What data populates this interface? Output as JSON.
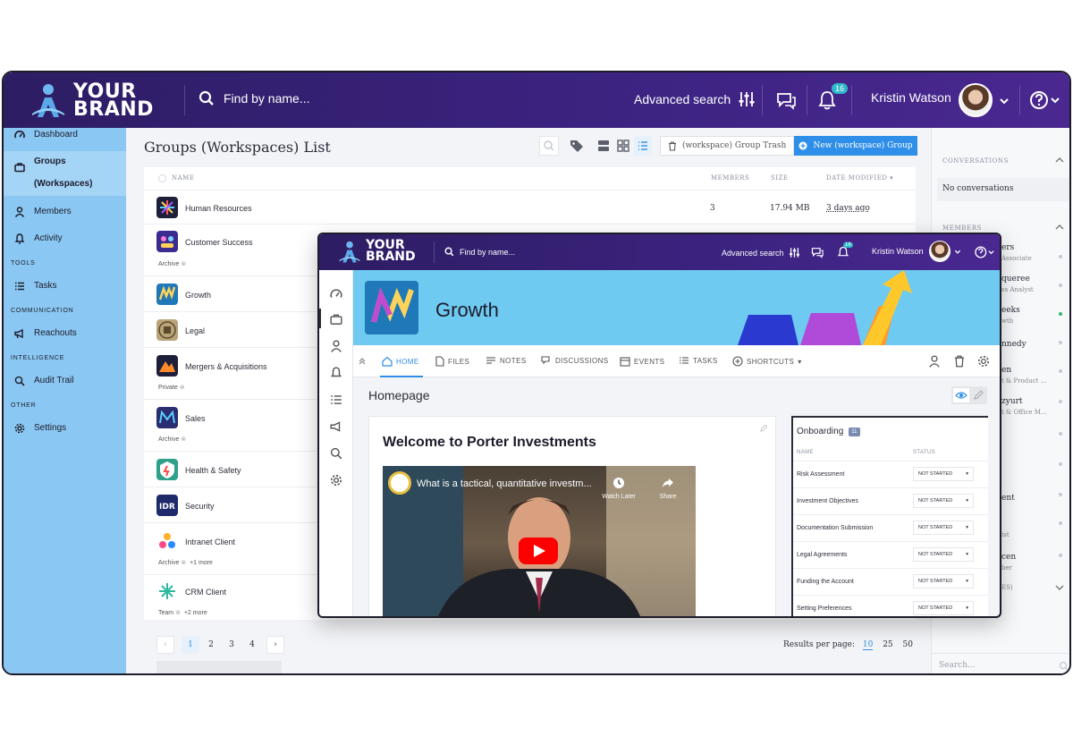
{
  "brand": {
    "line1": "YOUR",
    "line2": "BRAND"
  },
  "header": {
    "search_placeholder": "Find by name...",
    "advanced_search": "Advanced search",
    "notifications_count": "16",
    "user_name": "Kristin Watson"
  },
  "sidebar": {
    "items": [
      {
        "label": "Dashboard",
        "icon": "dashboard-icon"
      },
      {
        "label": "Groups (Workspaces)",
        "icon": "briefcase-icon",
        "active": true
      },
      {
        "label": "Members",
        "icon": "person-icon"
      },
      {
        "label": "Activity",
        "icon": "bell-icon"
      }
    ],
    "sections": {
      "tools": "TOOLS",
      "communication": "COMMUNICATION",
      "intelligence": "INTELLIGENCE",
      "other": "OTHER"
    },
    "tasks": "Tasks",
    "reachouts": "Reachouts",
    "audit_trail": "Audit Trail",
    "settings": "Settings"
  },
  "main": {
    "title": "Groups (Workspaces) List",
    "trash_label": "(workspace) Group Trash",
    "new_label": "New (workspace) Group",
    "columns": {
      "name": "NAME",
      "members": "MEMBERS",
      "size": "SIZE",
      "date_modified": "DATE MODIFIED"
    },
    "rows": [
      {
        "name": "Human Resources",
        "members": "3",
        "size": "17.94 MB",
        "modified": "3 days ago",
        "tag": "",
        "extra": ""
      },
      {
        "name": "Customer Success",
        "tag": "Archive",
        "extra": ""
      },
      {
        "name": "Growth",
        "tag": "",
        "extra": ""
      },
      {
        "name": "Legal",
        "tag": "",
        "extra": ""
      },
      {
        "name": "Mergers & Acquisitions",
        "tag": "Private",
        "extra": ""
      },
      {
        "name": "Sales",
        "tag": "Archive",
        "extra": ""
      },
      {
        "name": "Health & Safety",
        "tag": "",
        "extra": ""
      },
      {
        "name": "Security",
        "tag": "",
        "extra": ""
      },
      {
        "name": "Intranet Client",
        "tag": "Archive",
        "extra": "+1 more"
      },
      {
        "name": "CRM Client",
        "tag": "Team",
        "extra": "+2 more"
      }
    ],
    "pages": [
      "1",
      "2",
      "3",
      "4"
    ],
    "results_label": "Results per page:",
    "per_page": [
      "10",
      "25",
      "50"
    ]
  },
  "right_panel": {
    "conversations": "CONVERSATIONS",
    "no_conversations": "No conversations",
    "members": "MEMBERS",
    "partial": [
      {
        "name": "ers",
        "sub": "Associate"
      },
      {
        "name": "queree",
        "sub": "ss Analyst"
      },
      {
        "name": "eeks",
        "sub": "wth"
      },
      {
        "name": "nnedy",
        "sub": ""
      },
      {
        "name": "en",
        "sub": "t & Product ..."
      },
      {
        "name": "zyurt",
        "sub": "t & Office M..."
      },
      {
        "name": "ent",
        "sub": ""
      },
      {
        "name": "",
        "sub": "ist"
      },
      {
        "name": "cen",
        "sub": "ber"
      },
      {
        "name": "ES)",
        "sub": ""
      }
    ],
    "search_placeholder": "Search..."
  },
  "overlay": {
    "search_placeholder": "Find by name...",
    "advanced_search": "Advanced search",
    "notifications_count": "16",
    "user_name": "Kristin Watson",
    "group_title": "Growth",
    "tabs": [
      "HOME",
      "FILES",
      "NOTES",
      "DISCUSSIONS",
      "EVENTS",
      "TASKS",
      "SHORTCUTS"
    ],
    "homepage": "Homepage",
    "welcome": "Welcome to Porter Investments",
    "video_title": "What is a tactical, quantitative investm...",
    "video_watch_later": "Watch Later",
    "video_share": "Share",
    "onboarding": {
      "title": "Onboarding",
      "count": "11",
      "col_name": "NAME",
      "col_status": "STATUS",
      "rows": [
        {
          "name": "Risk Assessment",
          "status": "NOT STARTED"
        },
        {
          "name": "Investment Objectives",
          "status": "NOT STARTED"
        },
        {
          "name": "Documentation Submission",
          "status": "NOT STARTED"
        },
        {
          "name": "Legal Agreements",
          "status": "NOT STARTED"
        },
        {
          "name": "Funding the Account",
          "status": "NOT STARTED"
        },
        {
          "name": "Setting Preferences",
          "status": "NOT STARTED"
        }
      ]
    }
  },
  "colors": {
    "header": "#3b2380",
    "sidebar": "#8ac7f2",
    "accent": "#2f8fe8",
    "banner": "#6fcaf1",
    "badge": "#2fb8c9"
  }
}
